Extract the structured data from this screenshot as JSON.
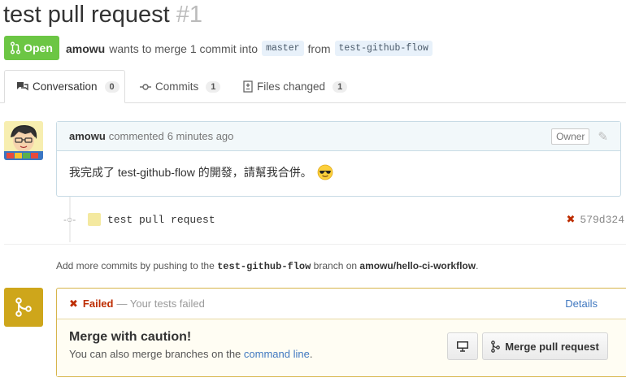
{
  "pr": {
    "title": "test pull request",
    "number": "#1",
    "state": "Open"
  },
  "meta": {
    "author": "amowu",
    "wants": "wants to merge 1 commit into",
    "base": "master",
    "from": "from",
    "head": "test-github-flow"
  },
  "tabs": [
    {
      "label": "Conversation",
      "count": "0"
    },
    {
      "label": "Commits",
      "count": "1"
    },
    {
      "label": "Files changed",
      "count": "1"
    }
  ],
  "comment": {
    "author": "amowu",
    "action": "commented",
    "time": "6 minutes ago",
    "role": "Owner",
    "body": "我完成了 test-github-flow 的開發，請幫我合併。"
  },
  "commit": {
    "message": "test pull request",
    "status": "✖",
    "sha": "579d324"
  },
  "hint": {
    "prefix": "Add more commits by pushing to the",
    "branch": "test-github-flow",
    "middle": "branch on",
    "repo": "amowu/hello-ci-workflow",
    "suffix": "."
  },
  "merge": {
    "status_icon": "✖",
    "status": "Failed",
    "status_detail": "— Your tests failed",
    "details_link": "Details",
    "heading": "Merge with caution!",
    "sub_prefix": "You can also merge branches on the",
    "sub_link": "command line",
    "sub_suffix": ".",
    "button": "Merge pull request"
  },
  "colors": {
    "open": "#6cc644",
    "fail": "#bd2c00",
    "link": "#4078c0",
    "caution": "#cea61b"
  }
}
